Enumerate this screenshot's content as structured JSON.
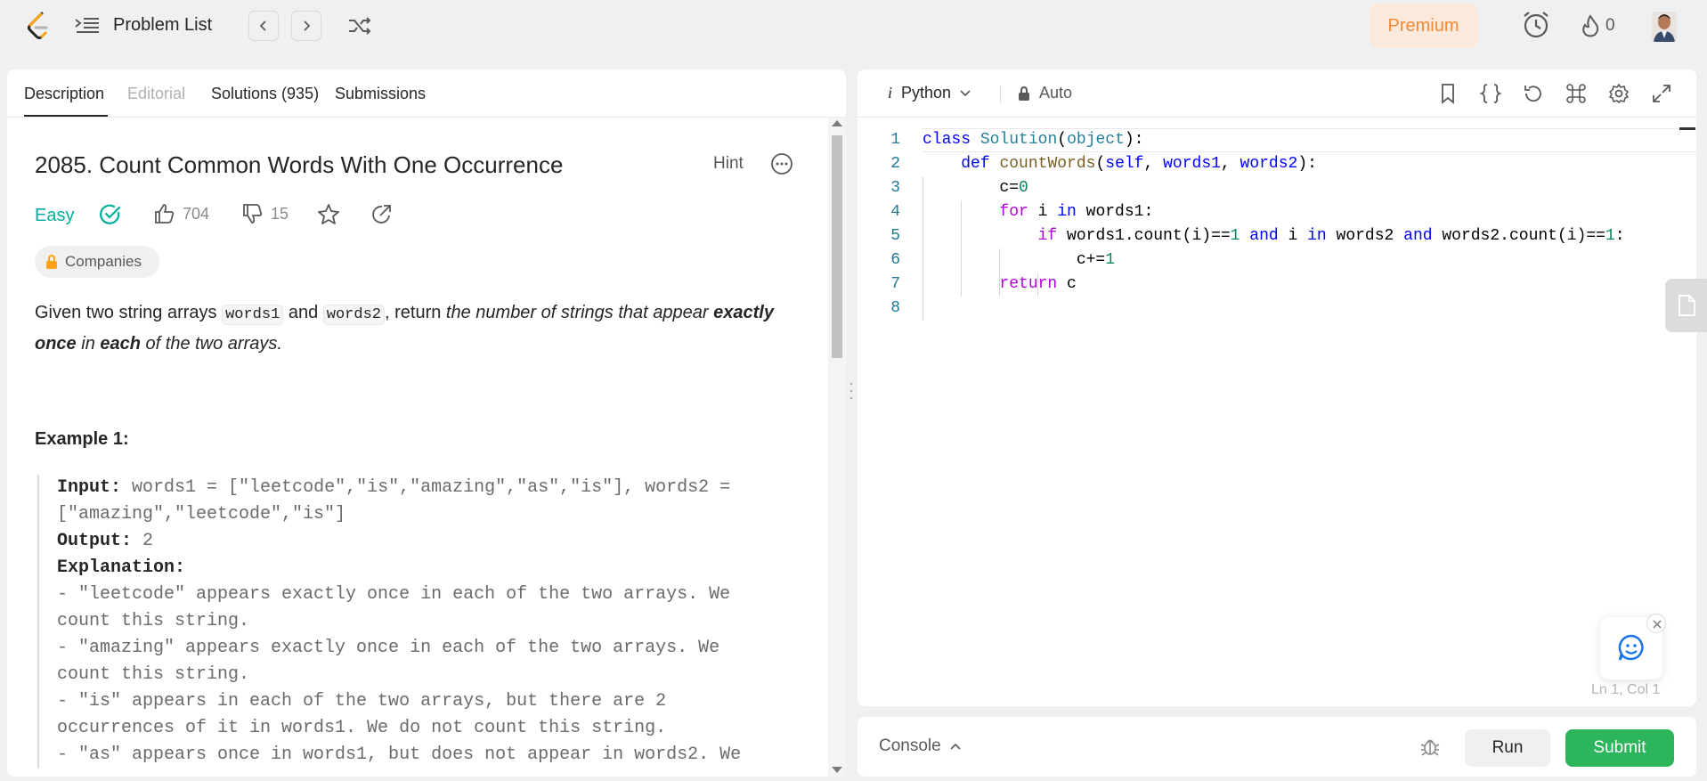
{
  "topbar": {
    "title": "Problem List",
    "premium_label": "Premium",
    "streak_count": "0",
    "icons": [
      "leetcode-logo",
      "list-icon",
      "chevron-left-icon",
      "chevron-right-icon",
      "shuffle-icon",
      "alarm-icon",
      "fire-icon",
      "avatar"
    ]
  },
  "left_tabs": [
    {
      "label": "Description",
      "state": "active"
    },
    {
      "label": "Editorial",
      "state": "disabled"
    },
    {
      "label": "Solutions (935)",
      "state": "normal"
    },
    {
      "label": "Submissions",
      "state": "normal"
    }
  ],
  "problem": {
    "title": "2085. Count Common Words With One Occurrence",
    "hint_label": "Hint",
    "difficulty": "Easy",
    "likes": "704",
    "dislikes": "15",
    "companies_label": "Companies",
    "description": {
      "p1": "Given two string arrays ",
      "code1": "words1",
      "p2": " and ",
      "code2": "words2",
      "p3": ", return ",
      "italic1": "the number of strings that appear ",
      "bold1": "exactly once",
      "italic2": " in ",
      "bold2": "each",
      "italic3": " of the two arrays."
    },
    "example_title": "Example 1:",
    "example": {
      "input_label": "Input:",
      "input_value": "words1 = [\"leetcode\",\"is\",\"amazing\",\"as\",\"is\"], words2 =",
      "input_value2": "[\"amazing\",\"leetcode\",\"is\"]",
      "output_label": "Output:",
      "output_value": "2",
      "explanation_label": "Explanation:",
      "lines": [
        "- \"leetcode\" appears exactly once in each of the two arrays. We",
        "count this string.",
        "- \"amazing\" appears exactly once in each of the two arrays. We",
        "count this string.",
        "- \"is\" appears in each of the two arrays, but there are 2",
        "occurrences of it in words1. We do not count this string.",
        "- \"as\" appears once in words1, but does not appear in words2. We"
      ]
    }
  },
  "editor": {
    "language": "Python",
    "language_icon": "i",
    "auto_label": "Auto",
    "cursor_position": "Ln 1, Col 1",
    "icons": [
      "bookmark-icon",
      "braces-icon",
      "reset-icon",
      "command-icon",
      "settings-icon",
      "expand-icon"
    ],
    "line_numbers": [
      "1",
      "2",
      "3",
      "4",
      "5",
      "6",
      "7",
      "8"
    ]
  },
  "bottom": {
    "console_label": "Console",
    "run_label": "Run",
    "submit_label": "Submit"
  },
  "colors": {
    "accent_green": "#2db55d",
    "easy": "#00af9b",
    "premium": "#f0893a"
  }
}
